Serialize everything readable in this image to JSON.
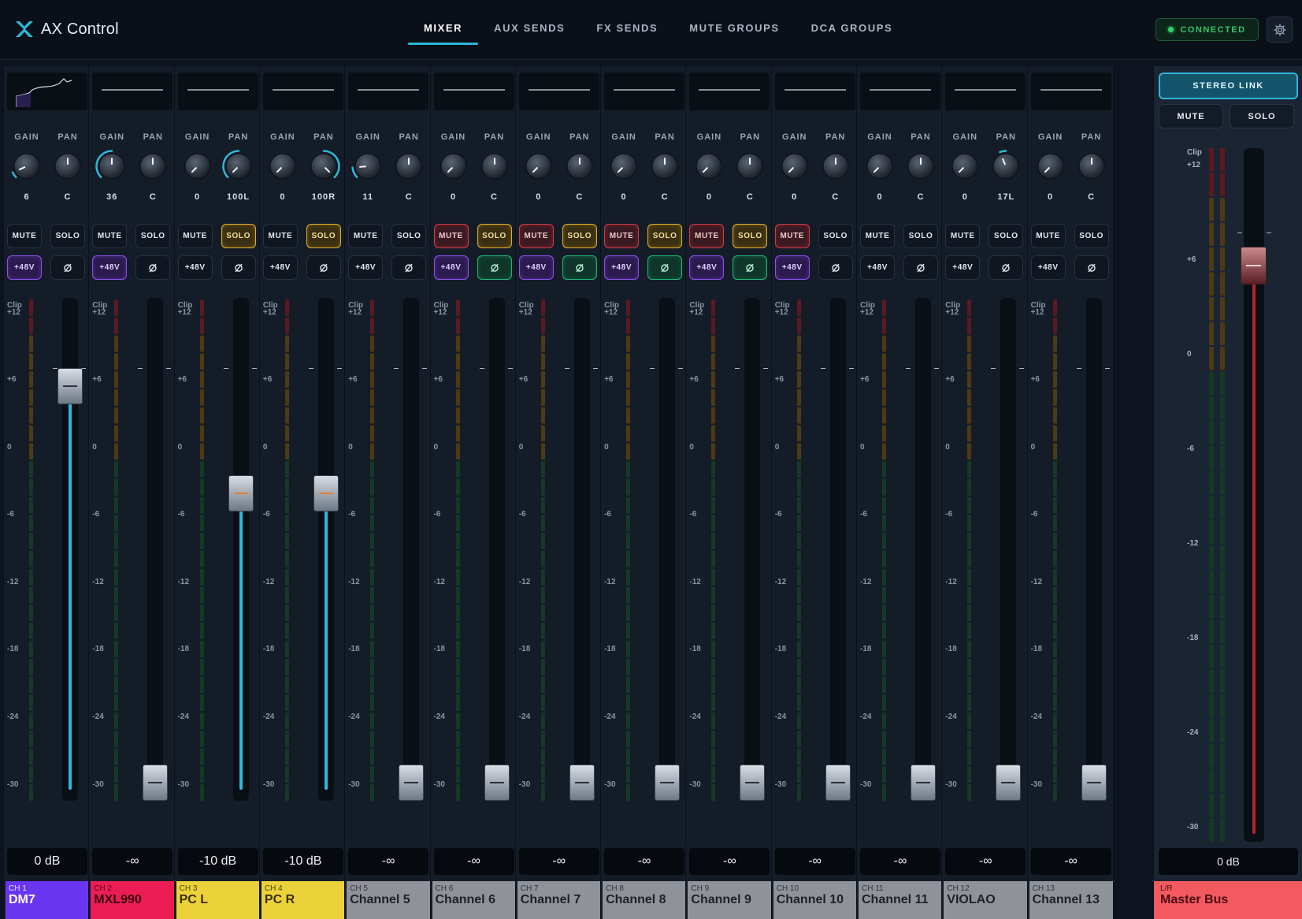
{
  "app": {
    "title": "AX Control"
  },
  "nav": {
    "tabs": [
      {
        "label": "MIXER",
        "active": true
      },
      {
        "label": "AUX SENDS",
        "active": false
      },
      {
        "label": "FX SENDS",
        "active": false
      },
      {
        "label": "MUTE GROUPS",
        "active": false
      },
      {
        "label": "DCA GROUPS",
        "active": false
      }
    ]
  },
  "status": {
    "label": "CONNECTED",
    "color": "#35c46a"
  },
  "labels": {
    "gain": "GAIN",
    "pan": "PAN",
    "mute": "MUTE",
    "solo": "SOLO",
    "phantom": "+48V",
    "clip": "Clip",
    "stereo_link": "STEREO LINK"
  },
  "meter_scale": [
    "+12",
    "+6",
    "0",
    "-6",
    "-12",
    "-18",
    "-24",
    "-30"
  ],
  "colors": {
    "accent": "#29b8d8",
    "master": "#f25a60"
  },
  "channels": [
    {
      "id": "CH 1",
      "name": "DM7",
      "color": "#6a35f0",
      "text_color": "#ffffff",
      "gain": "6",
      "gain_level": 0.08,
      "pan": "C",
      "pan_level": 0,
      "mute": false,
      "solo": false,
      "phantom": true,
      "phase": false,
      "fader_db": "0 dB",
      "fader_level": 0.85,
      "eq": true
    },
    {
      "id": "CH 2",
      "name": "MXL990",
      "color": "#ec1d55",
      "text_color": "#3a0410",
      "gain": "36",
      "gain_level": 0.5,
      "pan": "C",
      "pan_level": 0,
      "mute": false,
      "solo": false,
      "phantom": true,
      "phase": false,
      "fader_db": "-∞",
      "fader_level": 0,
      "eq": false
    },
    {
      "id": "CH 3",
      "name": "PC L",
      "color": "#ebd23a",
      "text_color": "#3a3000",
      "gain": "0",
      "gain_level": 0,
      "pan": "100L",
      "pan_level": -1,
      "mute": false,
      "solo": true,
      "phantom": false,
      "phase": false,
      "fader_db": "-10 dB",
      "fader_level": 0.62,
      "eq": false
    },
    {
      "id": "CH 4",
      "name": "PC R",
      "color": "#ebd23a",
      "text_color": "#3a3000",
      "gain": "0",
      "gain_level": 0,
      "pan": "100R",
      "pan_level": 1,
      "mute": false,
      "solo": true,
      "phantom": false,
      "phase": false,
      "fader_db": "-10 dB",
      "fader_level": 0.62,
      "eq": false
    },
    {
      "id": "CH 5",
      "name": "Channel 5",
      "color": "#8f9399",
      "text_color": "#1e2228",
      "gain": "11",
      "gain_level": 0.15,
      "pan": "C",
      "pan_level": 0,
      "mute": false,
      "solo": false,
      "phantom": false,
      "phase": false,
      "fader_db": "-∞",
      "fader_level": 0,
      "eq": false
    },
    {
      "id": "CH 6",
      "name": "Channel 6",
      "color": "#8f9399",
      "text_color": "#1e2228",
      "gain": "0",
      "gain_level": 0,
      "pan": "C",
      "pan_level": 0,
      "mute": true,
      "solo": true,
      "phantom": true,
      "phase": true,
      "fader_db": "-∞",
      "fader_level": 0,
      "eq": false
    },
    {
      "id": "CH 7",
      "name": "Channel 7",
      "color": "#8f9399",
      "text_color": "#1e2228",
      "gain": "0",
      "gain_level": 0,
      "pan": "C",
      "pan_level": 0,
      "mute": true,
      "solo": true,
      "phantom": true,
      "phase": true,
      "fader_db": "-∞",
      "fader_level": 0,
      "eq": false
    },
    {
      "id": "CH 8",
      "name": "Channel 8",
      "color": "#8f9399",
      "text_color": "#1e2228",
      "gain": "0",
      "gain_level": 0,
      "pan": "C",
      "pan_level": 0,
      "mute": true,
      "solo": true,
      "phantom": true,
      "phase": true,
      "fader_db": "-∞",
      "fader_level": 0,
      "eq": false
    },
    {
      "id": "CH 9",
      "name": "Channel 9",
      "color": "#8f9399",
      "text_color": "#1e2228",
      "gain": "0",
      "gain_level": 0,
      "pan": "C",
      "pan_level": 0,
      "mute": true,
      "solo": true,
      "phantom": true,
      "phase": true,
      "fader_db": "-∞",
      "fader_level": 0,
      "eq": false
    },
    {
      "id": "CH 10",
      "name": "Channel 10",
      "color": "#8f9399",
      "text_color": "#1e2228",
      "gain": "0",
      "gain_level": 0,
      "pan": "C",
      "pan_level": 0,
      "mute": true,
      "solo": false,
      "phantom": true,
      "phase": false,
      "fader_db": "-∞",
      "fader_level": 0,
      "eq": false
    },
    {
      "id": "CH 11",
      "name": "Channel 11",
      "color": "#8f9399",
      "text_color": "#1e2228",
      "gain": "0",
      "gain_level": 0,
      "pan": "C",
      "pan_level": 0,
      "mute": false,
      "solo": false,
      "phantom": false,
      "phase": false,
      "fader_db": "-∞",
      "fader_level": 0,
      "eq": false
    },
    {
      "id": "CH 12",
      "name": "VIOLAO",
      "color": "#8f9399",
      "text_color": "#1e2228",
      "gain": "0",
      "gain_level": 0,
      "pan": "17L",
      "pan_level": -0.17,
      "mute": false,
      "solo": false,
      "phantom": false,
      "phase": false,
      "fader_db": "-∞",
      "fader_level": 0,
      "eq": false
    },
    {
      "id": "CH 13",
      "name": "Channel 13",
      "color": "#8f9399",
      "text_color": "#1e2228",
      "gain": "0",
      "gain_level": 0,
      "pan": "C",
      "pan_level": 0,
      "mute": false,
      "solo": false,
      "phantom": false,
      "phase": false,
      "fader_db": "-∞",
      "fader_level": 0,
      "eq": false
    }
  ],
  "master": {
    "id": "L/R",
    "name": "Master Bus",
    "fader_db": "0 dB",
    "fader_level": 0.85,
    "scale": [
      "+12",
      "+6",
      "0",
      "-6",
      "-12",
      "-18",
      "-24",
      "-30"
    ]
  }
}
